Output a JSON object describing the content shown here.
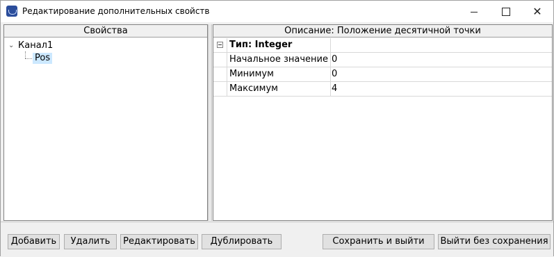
{
  "window": {
    "title": "Редактирование дополнительных свойств",
    "minimize": "—",
    "close": "✕"
  },
  "left": {
    "header": "Свойства",
    "tree": {
      "root": "Канал1",
      "expand_glyph": "⌄",
      "child": "Pos"
    }
  },
  "right": {
    "header": "Описание: Положение десятичной точки",
    "category": "Тип: Integer",
    "properties": [
      {
        "name": "Начальное значение",
        "value": "0"
      },
      {
        "name": "Минимум",
        "value": "0"
      },
      {
        "name": "Максимум",
        "value": "4"
      }
    ]
  },
  "buttons": {
    "add": "Добавить",
    "delete": "Удалить",
    "edit": "Редактировать",
    "duplicate": "Дублировать",
    "save_exit": "Сохранить и выйти",
    "exit_no_save": "Выйти без сохранения"
  }
}
